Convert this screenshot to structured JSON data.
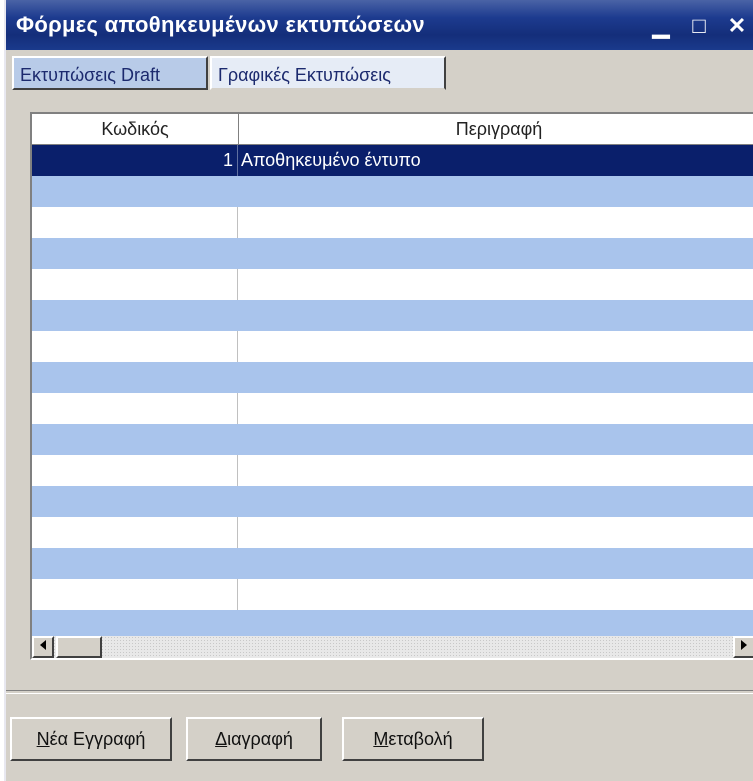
{
  "window": {
    "title": "Φόρμες αποθηκευμένων εκτυπώσεων",
    "minimize_glyph": "▁",
    "maximize_glyph": "□",
    "close_glyph": "✕"
  },
  "tabs": [
    {
      "label": "Εκτυπώσεις Draft",
      "active": true
    },
    {
      "label": "Γραφικές Εκτυπώσεις",
      "active": false
    }
  ],
  "table": {
    "columns": [
      "Κωδικός",
      "Περιγραφή"
    ],
    "rows": [
      {
        "code": "1",
        "description": "Αποθηκευμένο έντυπο",
        "selected": true
      }
    ],
    "colors": {
      "selected": "#0a1f6b",
      "stripe": "#a9c4ec"
    }
  },
  "scrollbar": {
    "left_icon": "arrow-left-icon",
    "right_icon": "arrow-right-icon"
  },
  "buttons": {
    "new": {
      "accel": "Ν",
      "rest": "έα Εγγραφή"
    },
    "delete": {
      "accel": "Δ",
      "rest": "ιαγραφή"
    },
    "edit": {
      "accel": "Μ",
      "rest": "εταβολή"
    }
  }
}
